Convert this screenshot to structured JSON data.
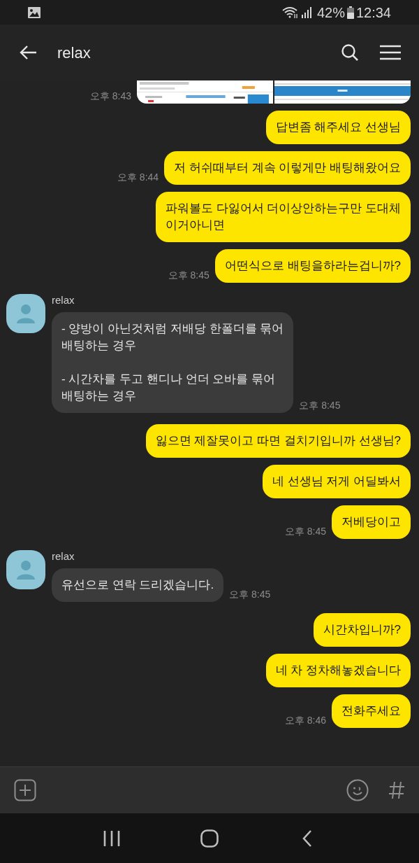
{
  "status_bar": {
    "battery": "42%",
    "time": "12:34"
  },
  "header": {
    "title": "relax"
  },
  "groups": [
    {
      "kind": "sent",
      "messages": [
        {
          "kind": "images",
          "time": "오후 8:43"
        },
        {
          "kind": "text",
          "text": "답변좀 해주세요 선생님"
        },
        {
          "kind": "text",
          "text": "저 허쉬때부터 계속 이렇게만 배팅해왔어요",
          "time": "오후 8:44"
        },
        {
          "kind": "text",
          "text": "파워볼도 다잃어서 더이상안하는구만 도대체\n이거아니면"
        },
        {
          "kind": "text",
          "text": "어떤식으로 배팅을하라는겁니까?",
          "time": "오후 8:45"
        }
      ]
    },
    {
      "kind": "received",
      "sender": "relax",
      "messages": [
        {
          "kind": "text",
          "text": "- 양방이 아닌것처럼 저배당 한폴더를 묶어\n배팅하는 경우\n\n- 시간차를 두고 핸디나 언더 오바를 묶어\n배팅하는 경우",
          "time": "오후 8:45"
        }
      ]
    },
    {
      "kind": "sent",
      "messages": [
        {
          "kind": "text",
          "text": "잃으면 제잘못이고 따면 걸치기입니까 선생님?"
        },
        {
          "kind": "text",
          "text": "네 선생님 저게 어딜봐서"
        },
        {
          "kind": "text",
          "text": "저베당이고",
          "time": "오후 8:45"
        }
      ]
    },
    {
      "kind": "received",
      "sender": "relax",
      "messages": [
        {
          "kind": "text",
          "text": "유선으로 연락 드리겠습니다.",
          "time": "오후 8:45"
        }
      ]
    },
    {
      "kind": "sent",
      "messages": [
        {
          "kind": "text",
          "text": "시간차입니까?"
        },
        {
          "kind": "text",
          "text": "네 차 정차해놓겠습니다"
        },
        {
          "kind": "text",
          "text": "전화주세요",
          "time": "오후 8:46"
        }
      ]
    }
  ]
}
